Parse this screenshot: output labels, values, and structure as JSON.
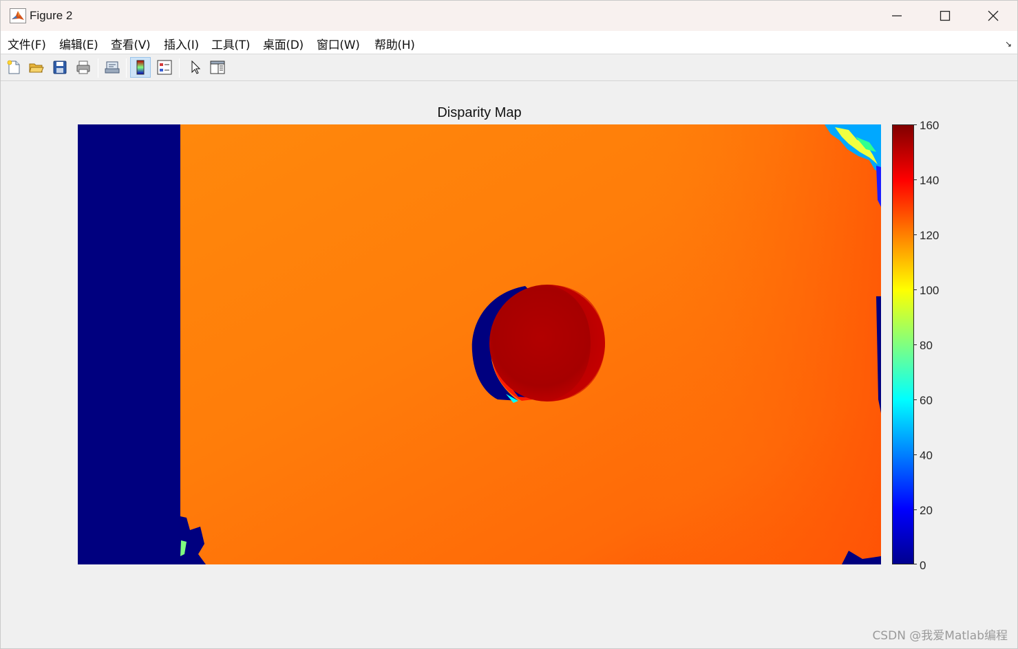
{
  "window": {
    "title": "Figure 2",
    "controls": {
      "minimize_icon": "minimize-icon",
      "maximize_icon": "maximize-icon",
      "close_icon": "close-icon"
    }
  },
  "menubar": {
    "items": [
      {
        "label": "文件(F)"
      },
      {
        "label": "编辑(E)"
      },
      {
        "label": "查看(V)"
      },
      {
        "label": "插入(I)"
      },
      {
        "label": "工具(T)"
      },
      {
        "label": "桌面(D)"
      },
      {
        "label": "窗口(W)"
      },
      {
        "label": "帮助(H)"
      }
    ],
    "dock_arrow": "↘"
  },
  "toolbar": {
    "buttons": [
      {
        "icon": "new-figure-icon"
      },
      {
        "icon": "open-file-icon"
      },
      {
        "icon": "save-icon"
      },
      {
        "icon": "print-icon"
      },
      {
        "icon": "link-figure-icon"
      },
      {
        "icon": "insert-colorbar-icon",
        "active": true
      },
      {
        "icon": "insert-legend-icon"
      },
      {
        "icon": "edit-plot-icon"
      },
      {
        "icon": "property-inspector-icon"
      }
    ]
  },
  "figure": {
    "title": "Disparity Map",
    "colormap": "jet",
    "colors": {
      "background_dark_blue": "#00007f",
      "orange": "#ff7a0a",
      "dark_red": "#b00000",
      "red": "#ff1a00"
    }
  },
  "colorbar": {
    "min": 0,
    "max": 160,
    "ticks": [
      "160",
      "140",
      "120",
      "100",
      "80",
      "60",
      "40",
      "20",
      "0"
    ]
  },
  "watermark": "CSDN @我爱Matlab编程"
}
